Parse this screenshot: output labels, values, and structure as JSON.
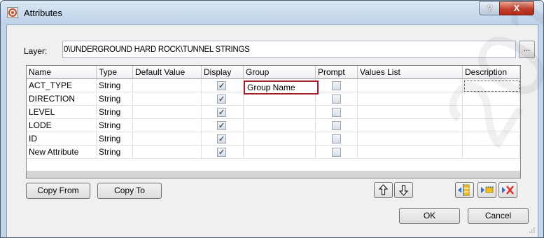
{
  "window": {
    "title": "Attributes",
    "help_label": "?",
    "close_label": "X"
  },
  "layer": {
    "label": "Layer:",
    "value": "0\\UNDERGROUND HARD ROCK\\TUNNEL STRINGS",
    "browse_label": "..."
  },
  "grid": {
    "columns": [
      "Name",
      "Type",
      "Default Value",
      "Display",
      "Group",
      "Prompt",
      "Values List",
      "Description"
    ],
    "rows": [
      {
        "name": "ACT_TYPE",
        "type": "String",
        "default": "",
        "display": true,
        "group": "Group Name",
        "prompt": false,
        "values": "",
        "description": ""
      },
      {
        "name": "DIRECTION",
        "type": "String",
        "default": "",
        "display": true,
        "group": "",
        "prompt": false,
        "values": "",
        "description": ""
      },
      {
        "name": "LEVEL",
        "type": "String",
        "default": "",
        "display": true,
        "group": "",
        "prompt": false,
        "values": "",
        "description": ""
      },
      {
        "name": "LODE",
        "type": "String",
        "default": "",
        "display": true,
        "group": "",
        "prompt": false,
        "values": "",
        "description": ""
      },
      {
        "name": "ID",
        "type": "String",
        "default": "",
        "display": true,
        "group": "",
        "prompt": false,
        "values": "",
        "description": ""
      },
      {
        "name": "New Attribute",
        "type": "String",
        "default": "",
        "display": true,
        "group": "",
        "prompt": false,
        "values": "",
        "description": ""
      }
    ]
  },
  "buttons": {
    "copy_from": "Copy From",
    "copy_to": "Copy To",
    "ok": "OK",
    "cancel": "Cancel"
  },
  "icons": [
    "move-up-icon",
    "move-down-icon",
    "insert-column-icon",
    "insert-row-icon",
    "delete-row-icon"
  ],
  "colors": {
    "highlight": "#a01f2a",
    "title_bar": "#c2d5ea",
    "delete_red": "#e03030",
    "insert_blue": "#2e6fd0",
    "insert_yellow": "#f0c020"
  },
  "watermark": "2017"
}
